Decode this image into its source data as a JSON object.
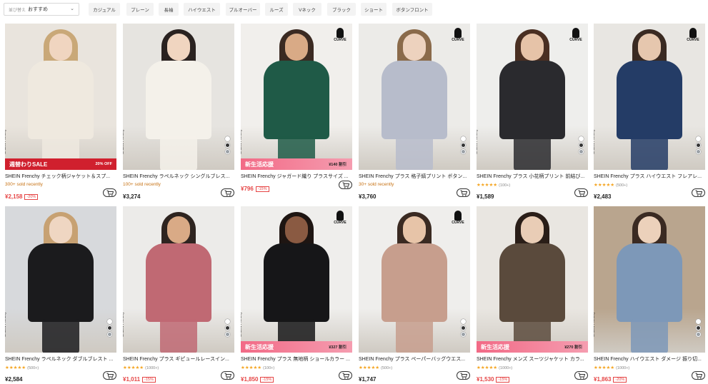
{
  "sort": {
    "prefix": "並び替え",
    "value": "おすすめ"
  },
  "chips": [
    "カジュアル",
    "プレーン",
    "長袖",
    "ハイウエスト",
    "プルオーバー",
    "ルーズ",
    "Vネック",
    "ブラック",
    "ショート",
    "ボタンフロント"
  ],
  "products": [
    {
      "title": "SHEIN Frenchy チェック柄ジャケット＆スプ...",
      "price": "¥2,158",
      "sale": true,
      "discount": "-20%",
      "sold": "300+ sold recently",
      "rating": "",
      "rating_count": "",
      "brand_vertical": "SHEIN Frenchy",
      "banner_left": "週替わりSALE",
      "banner_right": "20% OFF",
      "curve_label": "",
      "colors": {
        "bg": "#e9e4dd",
        "person": "#efe9df",
        "skin": "#f0d5c0",
        "hair": "#c9a878"
      }
    },
    {
      "title": "SHEIN Frenchy ラペルネック シングルブレス...",
      "price": "¥3,274",
      "sale": false,
      "discount": "",
      "sold": "100+ sold recently",
      "rating": "",
      "rating_count": "",
      "brand_vertical": "SHEIN Frenchy",
      "banner_left": "",
      "banner_right": "",
      "curve_label": "",
      "colors": {
        "bg": "#e6e4e0",
        "person": "#f4f1ea",
        "skin": "#f0d5c0",
        "hair": "#2a2220"
      }
    },
    {
      "title": "SHEIN Frenchy ジャガード織り プラスサイズ ...",
      "price": "¥796",
      "sale": true,
      "discount": "-15%",
      "sold": "",
      "rating": "",
      "rating_count": "",
      "brand_vertical": "SHEIN Frenchy",
      "banner_left": "新生活応援",
      "banner_right": "¥140 割引",
      "curve_label": "CURVE",
      "colors": {
        "bg": "#f1efec",
        "person": "#1f5a47",
        "skin": "#d9aa86",
        "hair": "#3b2a22"
      }
    },
    {
      "title": "SHEIN Frenchy プラス 格子縞プリント ボタン...",
      "price": "¥3,760",
      "sale": false,
      "discount": "",
      "sold": "30+ sold recently",
      "rating": "",
      "rating_count": "",
      "brand_vertical": "",
      "banner_left": "",
      "banner_right": "",
      "curve_label": "CURVE",
      "colors": {
        "bg": "#ecebe8",
        "person": "#b7bccb",
        "skin": "#edd2be",
        "hair": "#8a6a4a"
      }
    },
    {
      "title": "SHEIN Frenchy プラス 小花柄プリント 前結び...",
      "price": "¥1,589",
      "sale": false,
      "discount": "",
      "sold": "",
      "rating": "★★★★★",
      "rating_count": "(100+)",
      "brand_vertical": "SHEIN Frenchy",
      "banner_left": "",
      "banner_right": "",
      "curve_label": "CURVE",
      "colors": {
        "bg": "#eeeeec",
        "person": "#2a2a2e",
        "skin": "#e6c3a8",
        "hair": "#4a2f22"
      }
    },
    {
      "title": "SHEIN Frenchy プラス ハイウエスト フレアレ...",
      "price": "¥2,483",
      "sale": false,
      "discount": "",
      "sold": "",
      "rating": "★★★★★",
      "rating_count": "(500+)",
      "brand_vertical": "SHEIN Frenchy",
      "banner_left": "",
      "banner_right": "",
      "curve_label": "CURVE",
      "colors": {
        "bg": "#e8e6e2",
        "person": "#243c66",
        "skin": "#e6c7ae",
        "hair": "#3a2a22"
      }
    },
    {
      "title": "SHEIN Frenchy ラペルネック ダブルブレスト ...",
      "price": "¥2,584",
      "sale": false,
      "discount": "",
      "sold": "",
      "rating": "★★★★★",
      "rating_count": "(500+)",
      "brand_vertical": "SHEIN Frenchy",
      "banner_left": "",
      "banner_right": "",
      "curve_label": "",
      "colors": {
        "bg": "#d7d9dc",
        "person": "#1b1b1d",
        "skin": "#efd6c2",
        "hair": "#c7a172"
      }
    },
    {
      "title": "SHEIN Frenchy プラス ギピュールレースイン...",
      "price": "¥1,011",
      "sale": true,
      "discount": "-15%",
      "sold": "",
      "rating": "★★★★★",
      "rating_count": "(1000+)",
      "brand_vertical": "SHEIN Frenchy",
      "banner_left": "",
      "banner_right": "",
      "curve_label": "",
      "colors": {
        "bg": "#ecebe9",
        "person": "#c06973",
        "skin": "#d9aa86",
        "hair": "#2e2420"
      }
    },
    {
      "title": "SHEIN Frenchy プラス 無地柄 ショールカラー ...",
      "price": "¥1,850",
      "sale": true,
      "discount": "-15%",
      "sold": "",
      "rating": "★★★★★",
      "rating_count": "(100+)",
      "brand_vertical": "SHEIN Frenchy",
      "banner_left": "新生活応援",
      "banner_right": "¥327 割引",
      "curve_label": "CURVE",
      "colors": {
        "bg": "#efeeec",
        "person": "#161618",
        "skin": "#8a5a42",
        "hair": "#1e1512"
      }
    },
    {
      "title": "SHEIN Frenchy プラス ペーパーバッグウエス...",
      "price": "¥1,747",
      "sale": false,
      "discount": "",
      "sold": "",
      "rating": "★★★★★",
      "rating_count": "(500+)",
      "brand_vertical": "",
      "banner_left": "",
      "banner_right": "",
      "curve_label": "CURVE",
      "colors": {
        "bg": "#efeeec",
        "person": "#c79e8d",
        "skin": "#e7c4a8",
        "hair": "#3a2a22"
      }
    },
    {
      "title": "SHEIN Frenchy メンズ スーツジャケット カラ...",
      "price": "¥1,530",
      "sale": true,
      "discount": "-15%",
      "sold": "",
      "rating": "★★★★★",
      "rating_count": "(1000+)",
      "brand_vertical": "",
      "banner_left": "新生活応援",
      "banner_right": "¥270 割引",
      "curve_label": "",
      "colors": {
        "bg": "#e9e6e1",
        "person": "#5a4a3c",
        "skin": "#e9cdb6",
        "hair": "#2a1e18"
      }
    },
    {
      "title": "SHEIN Frenchy ハイウエスト ダメージ 振り切...",
      "price": "¥1,863",
      "sale": true,
      "discount": "-20%",
      "sold": "",
      "rating": "★★★★★",
      "rating_count": "(1000+)",
      "brand_vertical": "SHEIN Frenchy",
      "banner_left": "",
      "banner_right": "",
      "curve_label": "",
      "colors": {
        "bg": "#b9a58e",
        "person": "#7d98b8",
        "skin": "#ecd1bb",
        "hair": "#3a2a22"
      }
    }
  ]
}
